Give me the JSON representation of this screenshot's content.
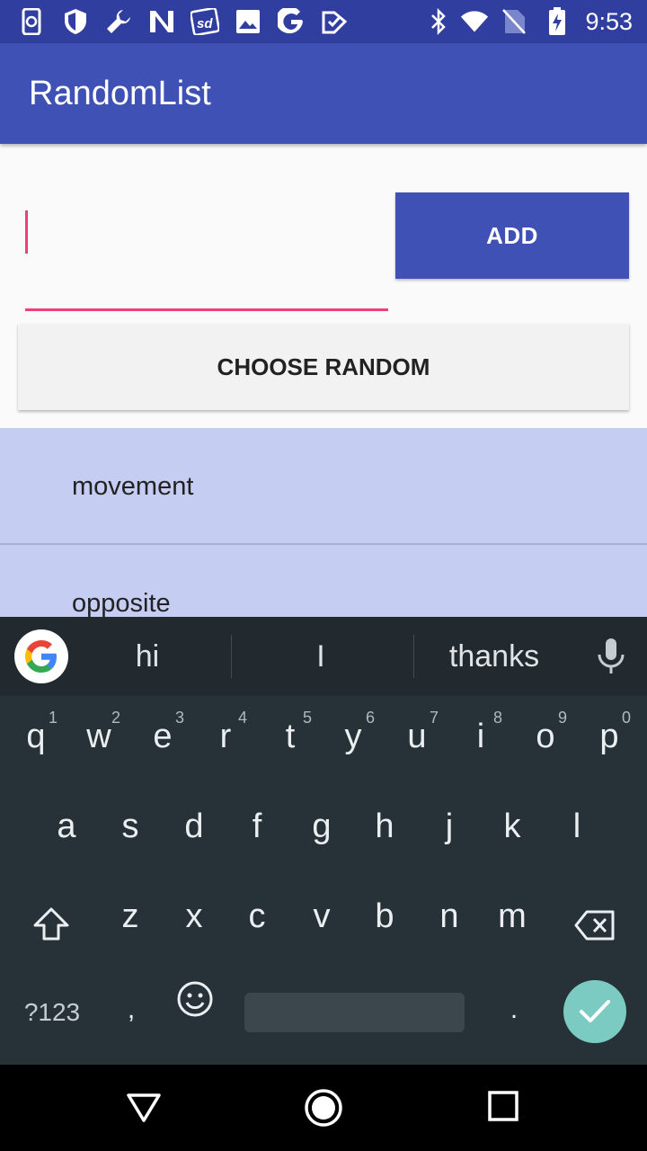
{
  "status_bar": {
    "time": "9:53",
    "icons": [
      "phone-sync-icon",
      "shield-icon",
      "wrench-icon",
      "n-icon",
      "sd-icon",
      "image-icon",
      "google-icon",
      "check-icon",
      "bluetooth-icon",
      "wifi-icon",
      "no-sim-icon",
      "battery-charging-icon"
    ]
  },
  "app": {
    "title": "RandomList",
    "add_label": "ADD",
    "choose_label": "CHOOSE RANDOM",
    "input_value": "",
    "accent_color": "#3f51b5",
    "input_accent": "#ec407a"
  },
  "list": {
    "items": [
      "movement",
      "opposite"
    ]
  },
  "keyboard": {
    "suggestions": [
      "hi",
      "I",
      "thanks"
    ],
    "row1": [
      "q",
      "w",
      "e",
      "r",
      "t",
      "y",
      "u",
      "i",
      "o",
      "p"
    ],
    "row1_hints": [
      "1",
      "2",
      "3",
      "4",
      "5",
      "6",
      "7",
      "8",
      "9",
      "0"
    ],
    "row2": [
      "a",
      "s",
      "d",
      "f",
      "g",
      "h",
      "j",
      "k",
      "l"
    ],
    "row3": [
      "z",
      "x",
      "c",
      "v",
      "b",
      "n",
      "m"
    ],
    "symbols_label": "?123",
    "comma": ",",
    "period": "."
  },
  "nav_bar": {
    "icons": [
      "back-icon",
      "home-icon",
      "recents-icon"
    ]
  }
}
